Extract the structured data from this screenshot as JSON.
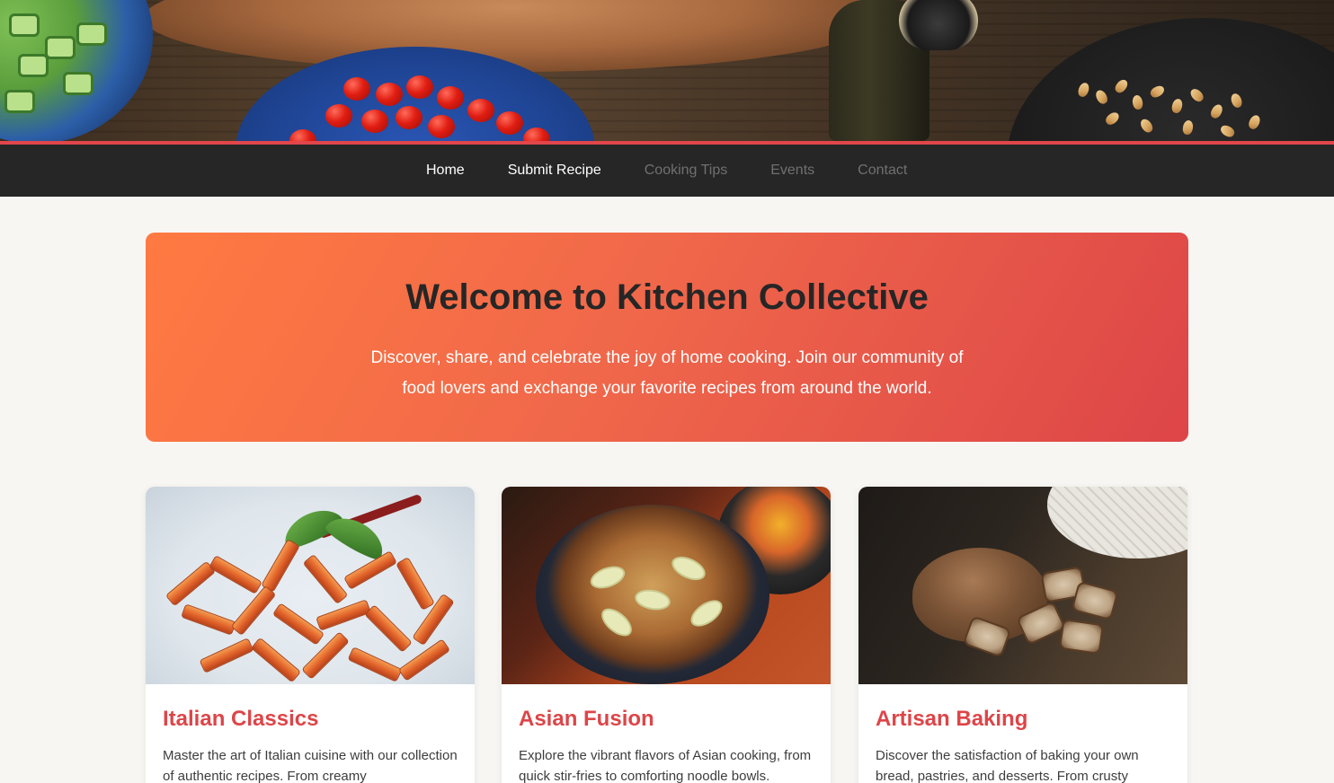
{
  "nav": {
    "items": [
      {
        "label": "Home",
        "state": "active"
      },
      {
        "label": "Submit Recipe",
        "state": "active"
      },
      {
        "label": "Cooking Tips",
        "state": "dim"
      },
      {
        "label": "Events",
        "state": "dim"
      },
      {
        "label": "Contact",
        "state": "dim"
      }
    ]
  },
  "welcome": {
    "title": "Welcome to Kitchen Collective",
    "text": "Discover, share, and celebrate the joy of home cooking. Join our community of food lovers and exchange your favorite recipes from around the world."
  },
  "cards": [
    {
      "title": "Italian Classics",
      "description": "Master the art of Italian cuisine with our collection of authentic recipes. From creamy"
    },
    {
      "title": "Asian Fusion",
      "description": "Explore the vibrant flavors of Asian cooking, from quick stir-fries to comforting noodle bowls."
    },
    {
      "title": "Artisan Baking",
      "description": "Discover the satisfaction of baking your own bread, pastries, and desserts. From crusty"
    }
  ],
  "colors": {
    "accent": "#dd4548",
    "nav_background": "#262626",
    "banner_gradient_start": "#ff7a42",
    "banner_gradient_end": "#dd4548",
    "page_background": "#f7f6f3"
  }
}
